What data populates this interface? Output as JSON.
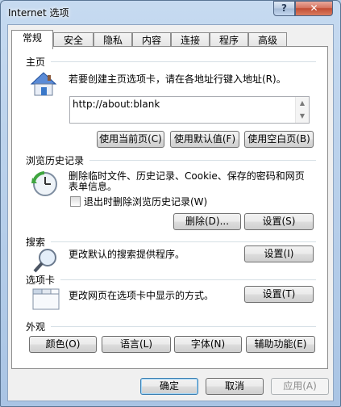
{
  "window": {
    "title": "Internet 选项",
    "help_label": "?",
    "close_label": "✕"
  },
  "tabs": [
    {
      "label": "常规",
      "active": true
    },
    {
      "label": "安全"
    },
    {
      "label": "隐私"
    },
    {
      "label": "内容"
    },
    {
      "label": "连接"
    },
    {
      "label": "程序"
    },
    {
      "label": "高级"
    }
  ],
  "homepage": {
    "section_label": "主页",
    "description": "若要创建主页选项卡，请在各地址行键入地址(R)。",
    "address_value": "http://about:blank",
    "use_current_label": "使用当前页(C)",
    "use_default_label": "使用默认值(F)",
    "use_blank_label": "使用空白页(B)"
  },
  "history": {
    "section_label": "浏览历史记录",
    "description_line1": "删除临时文件、历史记录、Cookie、保存的密码和网页",
    "description_line2": "表单信息。",
    "checkbox_label": "退出时删除浏览历史记录(W)",
    "checkbox_checked": false,
    "delete_label": "删除(D)...",
    "settings_label": "设置(S)"
  },
  "search": {
    "section_label": "搜索",
    "description": "更改默认的搜索提供程序。",
    "settings_label": "设置(I)"
  },
  "tabs_section": {
    "section_label": "选项卡",
    "description": "更改网页在选项卡中显示的方式。",
    "settings_label": "设置(T)"
  },
  "appearance": {
    "section_label": "外观",
    "colors_label": "颜色(O)",
    "languages_label": "语言(L)",
    "fonts_label": "字体(N)",
    "accessibility_label": "辅助功能(E)"
  },
  "footer": {
    "ok_label": "确定",
    "cancel_label": "取消",
    "apply_label": "应用(A)"
  }
}
